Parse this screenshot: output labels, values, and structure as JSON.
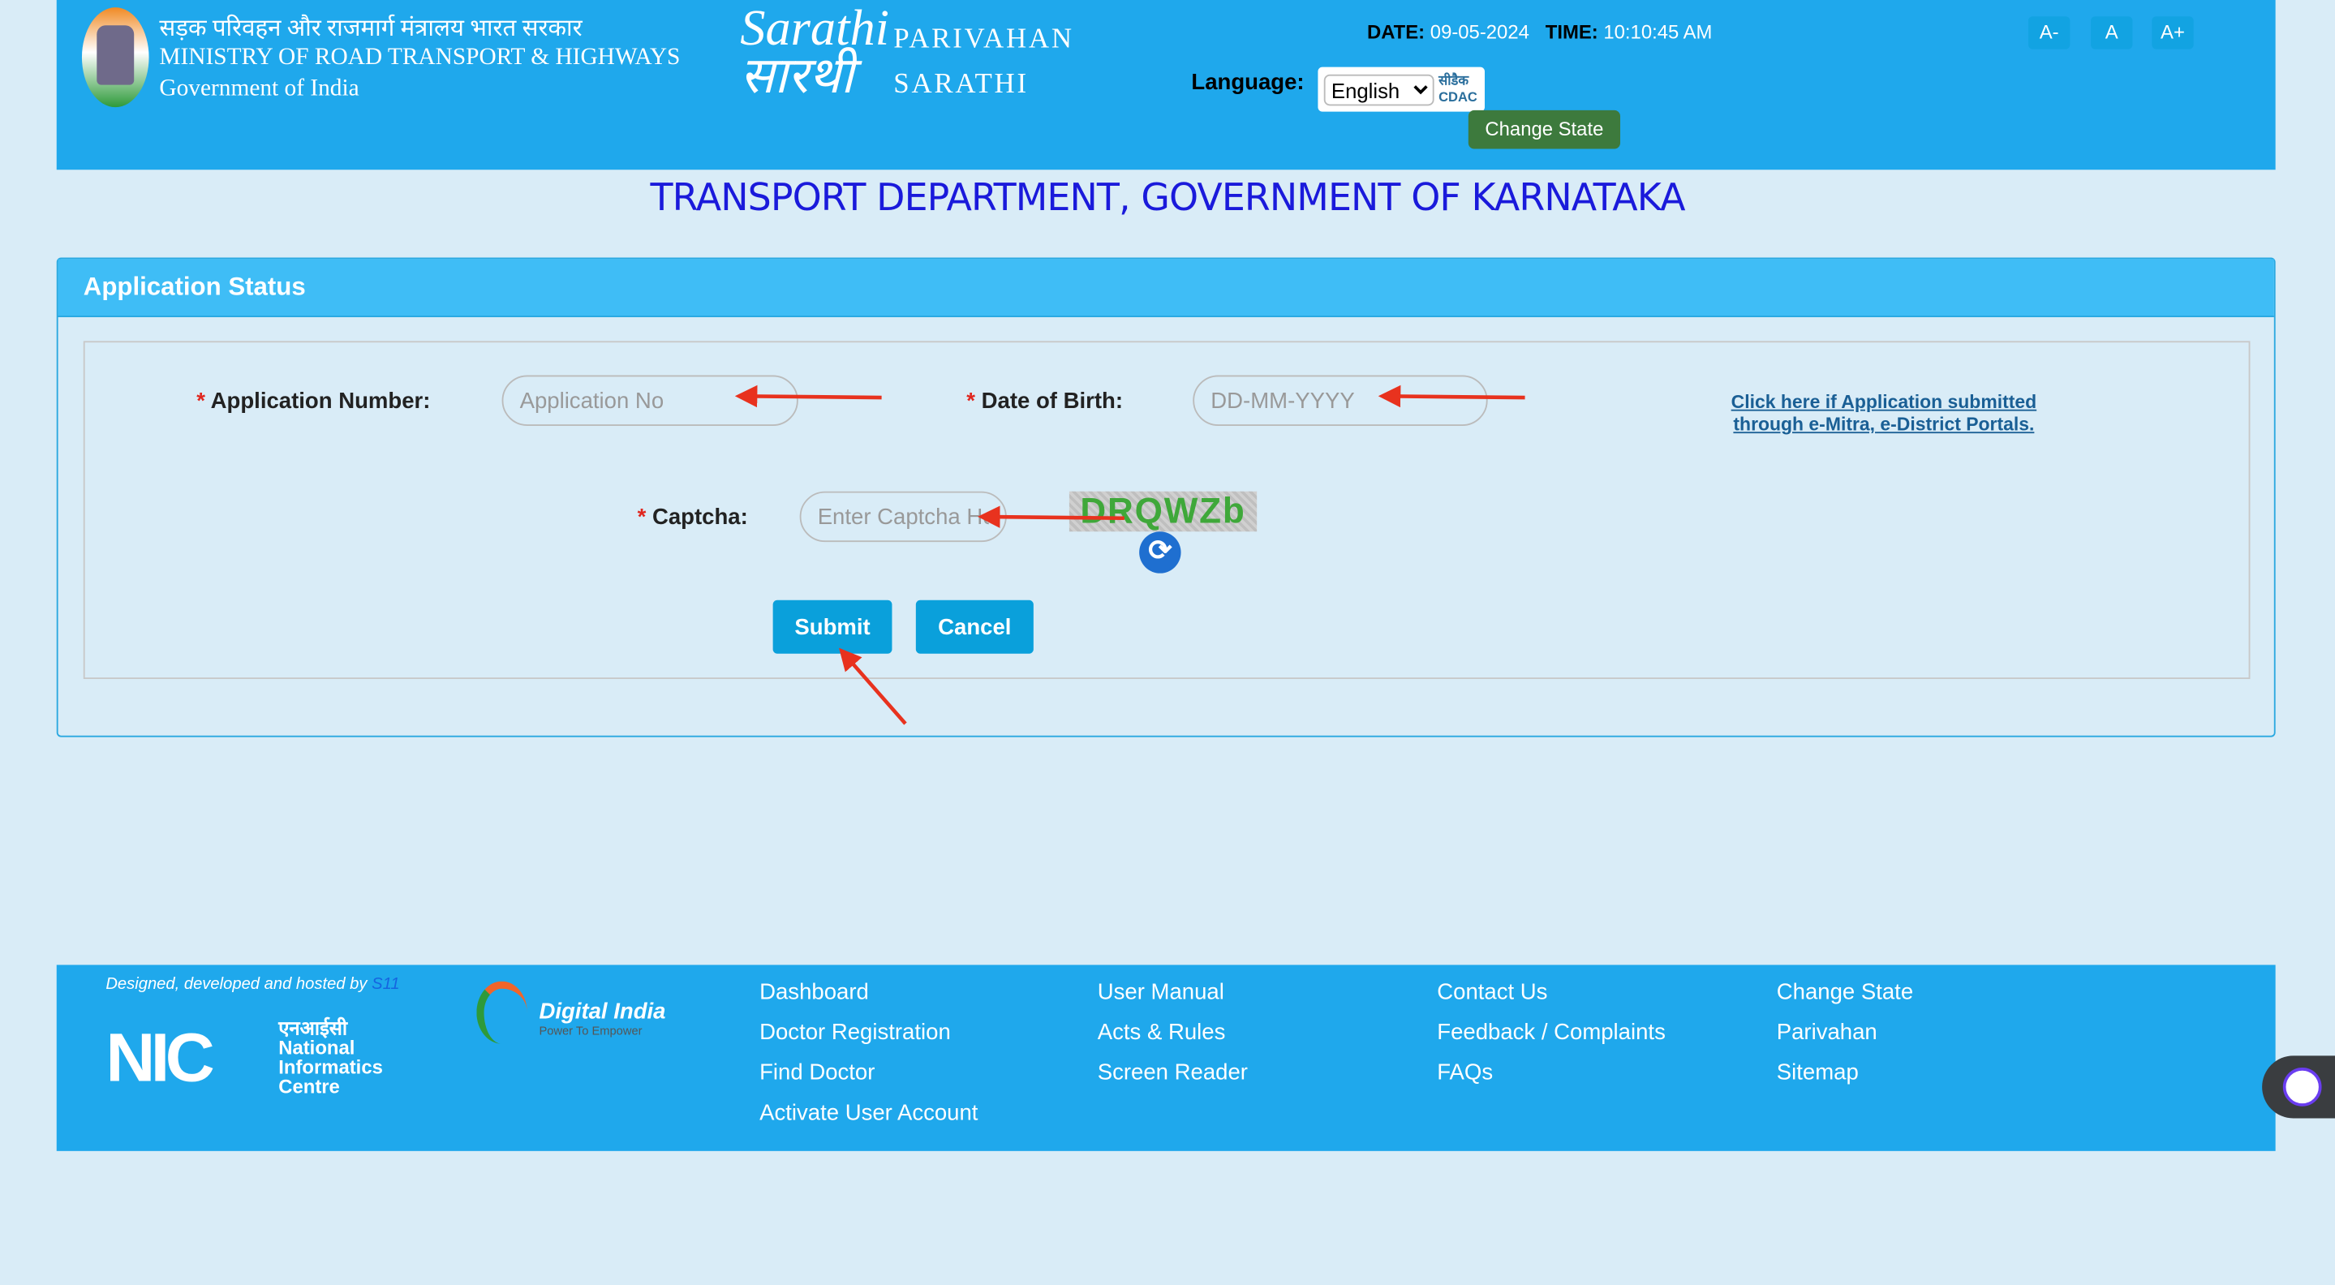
{
  "header": {
    "ministry_hindi": "सड़क परिवहन और राजमार्ग मंत्रालय भारत सरकार",
    "ministry_english": "MINISTRY OF ROAD TRANSPORT & HIGHWAYS",
    "government": "Government of India",
    "logo_text": "Sarathi सारथी",
    "brand_line1": "PARIVAHAN",
    "brand_line2": "SARATHI",
    "date_label": "DATE:",
    "date_value": "09-05-2024",
    "time_label": "TIME:",
    "time_value": "10:10:45 AM",
    "font_buttons": [
      "A-",
      "A",
      "A+"
    ],
    "language_label": "Language:",
    "language_selected": "English",
    "cdac_logo": "सीडैक CDAC",
    "change_state": "Change State"
  },
  "page_title": "TRANSPORT DEPARTMENT, GOVERNMENT OF KARNATAKA",
  "panel": {
    "title": "Application Status",
    "app_no_label": "Application Number:",
    "app_no_placeholder": "Application No",
    "dob_label": "Date of Birth:",
    "dob_placeholder": "DD-MM-YYYY",
    "portal_link": "Click here if Application submitted through e-Mitra, e-District Portals.",
    "captcha_label": "Captcha:",
    "captcha_placeholder": "Enter Captcha Here",
    "captcha_text": "DRQWZb",
    "required_mark": "*",
    "submit": "Submit",
    "cancel": "Cancel"
  },
  "footer": {
    "credit_prefix": "Designed, developed and hosted by",
    "credit_org": "S11",
    "nic_logo": "NIC एनआईसी National Informatics Centre",
    "digital_india_logo": "Digital India Power To Empower",
    "columns": [
      [
        "Dashboard",
        "Doctor Registration",
        "Find Doctor",
        "Activate User Account"
      ],
      [
        "User Manual",
        "Acts & Rules",
        "Screen Reader"
      ],
      [
        "Contact Us",
        "Feedback / Complaints",
        "FAQs"
      ],
      [
        "Change State",
        "Parivahan",
        "Sitemap"
      ]
    ]
  },
  "colors": {
    "header_bg": "#1fa8ec",
    "page_bg": "#d9ecf7",
    "title": "#1a1adb",
    "button": "#0aa0db",
    "change_state": "#3d7a3d",
    "annotation_arrow": "#e8321e"
  }
}
